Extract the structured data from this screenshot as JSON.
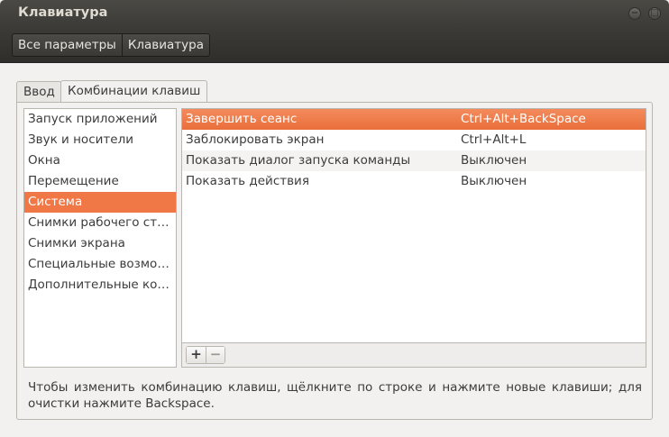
{
  "window": {
    "title": "Клавиатура",
    "minimize_glyph": "−",
    "maximize_glyph": "□"
  },
  "breadcrumb": [
    "Все параметры",
    "Клавиатура"
  ],
  "tabs": [
    {
      "label": "Ввод",
      "active": false
    },
    {
      "label": "Комбинации клавиш",
      "active": true
    }
  ],
  "categories": [
    {
      "label": "Запуск приложений",
      "selected": false
    },
    {
      "label": "Звук и носители",
      "selected": false
    },
    {
      "label": "Окна",
      "selected": false
    },
    {
      "label": "Перемещение",
      "selected": false
    },
    {
      "label": "Система",
      "selected": true
    },
    {
      "label": "Снимки рабочего стола",
      "selected": false
    },
    {
      "label": "Снимки экрана",
      "selected": false
    },
    {
      "label": "Специальные возможности",
      "selected": false
    },
    {
      "label": "Дополнительные комбинации",
      "selected": false
    }
  ],
  "shortcuts": [
    {
      "action": "Завершить сеанс",
      "accel": "Ctrl+Alt+BackSpace",
      "selected": true
    },
    {
      "action": "Заблокировать экран",
      "accel": "Ctrl+Alt+L",
      "selected": false
    },
    {
      "action": "Показать диалог запуска команды",
      "accel": "Выключен",
      "selected": false
    },
    {
      "action": "Показать действия",
      "accel": "Выключен",
      "selected": false
    }
  ],
  "table_toolbar": {
    "add": "+",
    "remove": "−"
  },
  "hint": "Чтобы изменить комбинацию клавиш, щёлкните по строке и нажмите новые клавиши; для очистки нажмите Backspace.",
  "colors": {
    "accent": "#f07746",
    "titlebar": "#3c3b37"
  }
}
